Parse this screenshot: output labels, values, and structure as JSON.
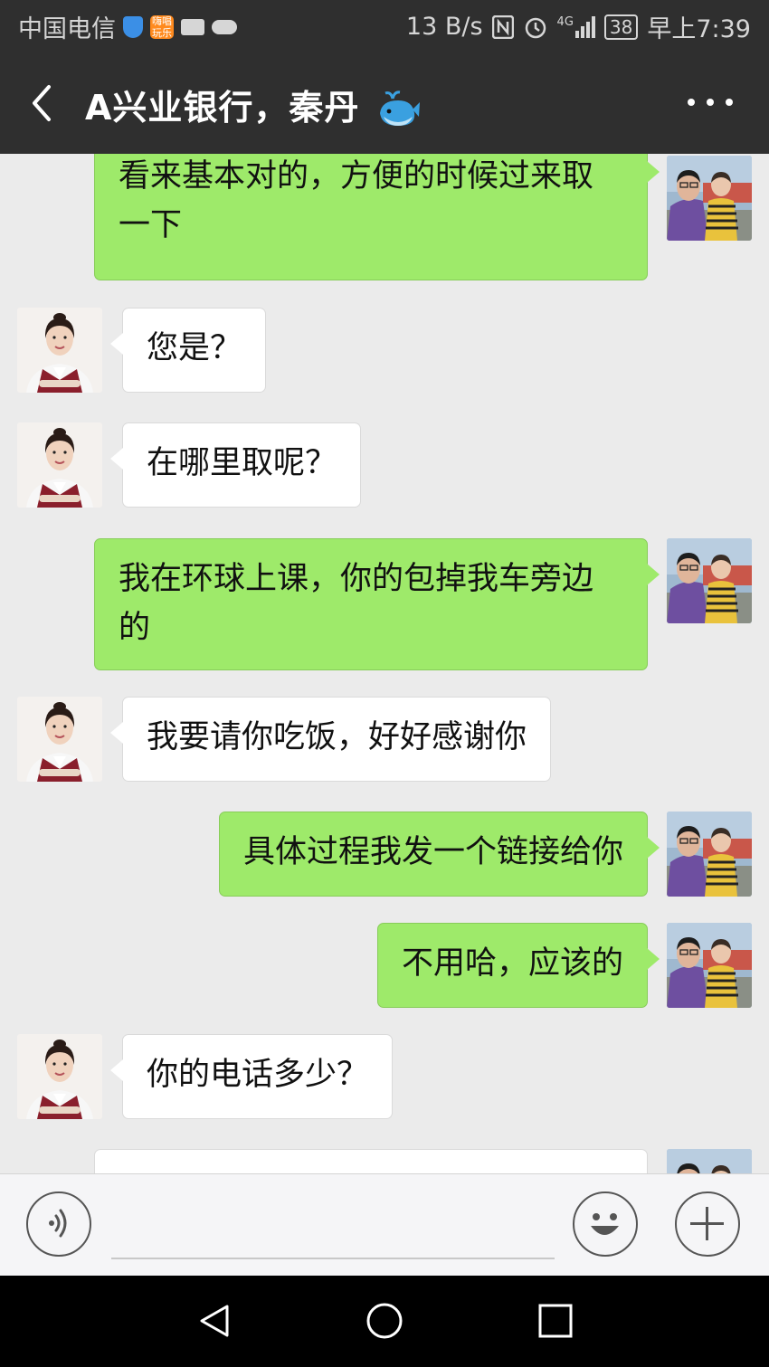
{
  "status_bar": {
    "carrier": "中国电信",
    "game_icon_text": "嗨唱玩乐",
    "net_speed": "13 B/s",
    "signal": "4G",
    "battery": "38",
    "time": "早上7:39",
    "icons": [
      "shield-icon",
      "game-app-icon",
      "briefcase-icon",
      "cloud-icon",
      "nfc-icon",
      "alarm-icon",
      "signal-icon",
      "battery-icon"
    ]
  },
  "header": {
    "title": "A兴业银行，秦丹",
    "title_emoji": "whale-emoji",
    "icons": [
      "back-icon",
      "more-icon"
    ]
  },
  "messages": [
    {
      "sender": "me",
      "text": "看来基本对的，方便的时候过来取一下"
    },
    {
      "sender": "them",
      "text": "您是？"
    },
    {
      "sender": "them",
      "text": "在哪里取呢？"
    },
    {
      "sender": "me",
      "text": "我在环球上课，你的包掉我车旁边的"
    },
    {
      "sender": "them",
      "text": "我要请你吃饭，好好感谢你"
    },
    {
      "sender": "me",
      "text": "具体过程我发一个链接给你"
    },
    {
      "sender": "me",
      "text": "不用哈，应该的"
    },
    {
      "sender": "them",
      "text": "你的电话多少？"
    },
    {
      "sender": "me",
      "text": ""
    }
  ],
  "input_bar": {
    "value": "",
    "icons": [
      "voice-icon",
      "emoji-icon",
      "plus-icon"
    ]
  },
  "nav_bar": {
    "icons": [
      "nav-back-icon",
      "nav-home-icon",
      "nav-recents-icon"
    ]
  },
  "colors": {
    "header_bg": "#2f2f2f",
    "chat_bg": "#ebebeb",
    "my_bubble": "#9eea6a",
    "their_bubble": "#ffffff"
  }
}
